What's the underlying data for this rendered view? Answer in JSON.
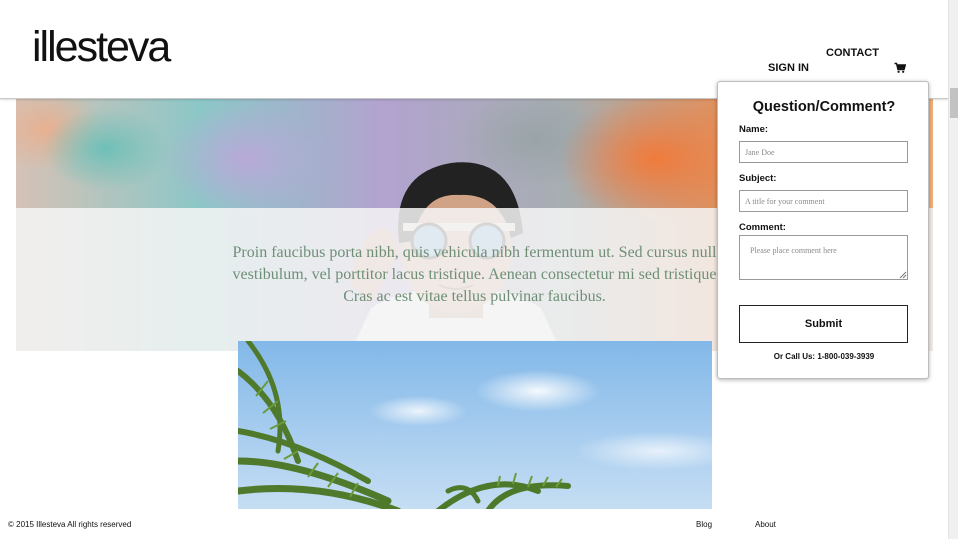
{
  "header": {
    "logo": "illesteva",
    "nav": {
      "contact": "CONTACT",
      "sign_in": "SIGN IN"
    },
    "cart_icon": "shopping-cart-icon"
  },
  "hero": {
    "text_lines": [
      "Proin faucibus porta nibh, quis vehicula nibh fermentum ut. Sed cursus null",
      "vestibulum, vel porttitor lacus tristique. Aenean consectetur mi sed tristique",
      "Cras ac est vitae tellus pulvinar faucibus."
    ]
  },
  "form": {
    "title": "Question/Comment?",
    "name_label": "Name:",
    "name_placeholder": "Jane Doe",
    "subject_label": "Subject:",
    "subject_placeholder": "A title for your comment",
    "comment_label": "Comment:",
    "comment_placeholder": "Please place comment here",
    "submit_label": "Submit",
    "call_us": "Or Call Us: 1-800-039-3939"
  },
  "footer": {
    "copyright": "© 2015 Illesteva  All rights reserved",
    "blog": "Blog",
    "about": "About"
  },
  "colors": {
    "hero_text": "#6e8f76",
    "overlay": "#f5f5f5",
    "border": "#bdbdbd"
  }
}
